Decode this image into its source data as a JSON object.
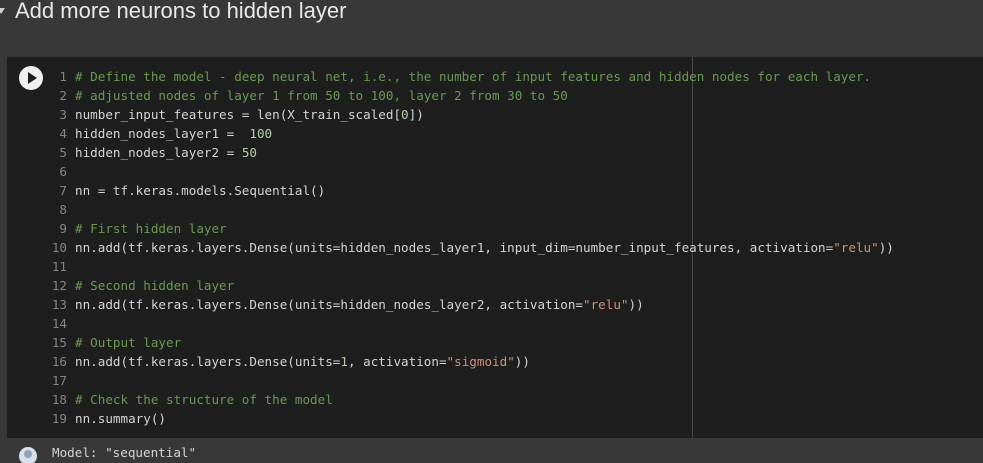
{
  "section": {
    "title": "Add more neurons to hidden layer",
    "caret_icon": "chevron-down-icon"
  },
  "cell": {
    "run_icon": "play-icon",
    "lines": [
      {
        "n": "1",
        "tokens": [
          {
            "t": "cm",
            "v": "# Define the model - deep neural net, i.e., the number of input features and hidden nodes for each layer."
          }
        ]
      },
      {
        "n": "2",
        "tokens": [
          {
            "t": "cm",
            "v": "# adjusted nodes of layer 1 from 50 to 100, layer 2 from 30 to 50"
          }
        ]
      },
      {
        "n": "3",
        "tokens": [
          {
            "t": "",
            "v": "number_input_features = len(X_train_scaled["
          },
          {
            "t": "nm",
            "v": "0"
          },
          {
            "t": "",
            "v": "])"
          }
        ]
      },
      {
        "n": "4",
        "tokens": [
          {
            "t": "",
            "v": "hidden_nodes_layer1 =  "
          },
          {
            "t": "nm",
            "v": "100"
          }
        ]
      },
      {
        "n": "5",
        "tokens": [
          {
            "t": "",
            "v": "hidden_nodes_layer2 = "
          },
          {
            "t": "nm",
            "v": "50"
          }
        ]
      },
      {
        "n": "6",
        "tokens": []
      },
      {
        "n": "7",
        "tokens": [
          {
            "t": "",
            "v": "nn = tf.keras.models.Sequential()"
          }
        ]
      },
      {
        "n": "8",
        "tokens": []
      },
      {
        "n": "9",
        "tokens": [
          {
            "t": "cm",
            "v": "# First hidden layer"
          }
        ]
      },
      {
        "n": "10",
        "tokens": [
          {
            "t": "",
            "v": "nn.add(tf.keras.layers.Dense(units=hidden_nodes_layer1, input_dim=number_input_features, activation="
          },
          {
            "t": "st",
            "v": "\"relu\""
          },
          {
            "t": "",
            "v": "))"
          }
        ]
      },
      {
        "n": "11",
        "tokens": []
      },
      {
        "n": "12",
        "tokens": [
          {
            "t": "cm",
            "v": "# Second hidden layer"
          }
        ]
      },
      {
        "n": "13",
        "tokens": [
          {
            "t": "",
            "v": "nn.add(tf.keras.layers.Dense(units=hidden_nodes_layer2, activation="
          },
          {
            "t": "st",
            "v": "\"relu\""
          },
          {
            "t": "",
            "v": "))"
          }
        ]
      },
      {
        "n": "14",
        "tokens": []
      },
      {
        "n": "15",
        "tokens": [
          {
            "t": "cm",
            "v": "# Output layer"
          }
        ]
      },
      {
        "n": "16",
        "tokens": [
          {
            "t": "",
            "v": "nn.add(tf.keras.layers.Dense(units="
          },
          {
            "t": "nm",
            "v": "1"
          },
          {
            "t": "",
            "v": ", activation="
          },
          {
            "t": "st",
            "v": "\"sigmoid\""
          },
          {
            "t": "",
            "v": "))"
          }
        ]
      },
      {
        "n": "17",
        "tokens": []
      },
      {
        "n": "18",
        "tokens": [
          {
            "t": "cm",
            "v": "# Check the structure of the model"
          }
        ]
      },
      {
        "n": "19",
        "tokens": [
          {
            "t": "",
            "v": "nn.summary()"
          }
        ]
      }
    ]
  },
  "output": {
    "avatar_icon": "user-avatar-icon",
    "text": "Model: \"sequential\""
  },
  "colors": {
    "comment": "#6a9955",
    "string": "#ce9178",
    "number": "#b5cea8",
    "code_bg": "#1e1e1e",
    "page_bg": "#383838"
  }
}
